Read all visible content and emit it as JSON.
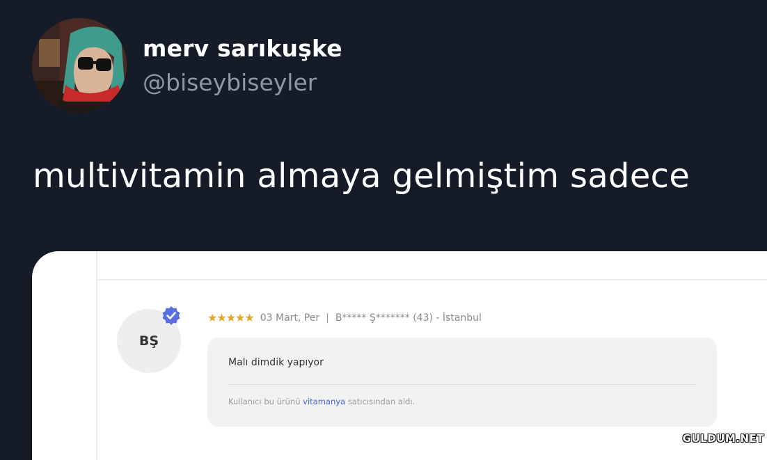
{
  "tweet": {
    "display_name": "merv sarıkuşke",
    "handle": "@biseybiseyler",
    "text": "multivitamin almaya gelmiştim sadece"
  },
  "review": {
    "user_initials": "BŞ",
    "stars": "★★★★★",
    "rating": 5,
    "date": "03 Mart, Per",
    "separator": "|",
    "reviewer": "B***** Ş******* (43) - İstanbul",
    "comment": "Malı dimdik yapıyor",
    "source_prefix": "Kullanıcı bu ürünü ",
    "seller": "vitamanya",
    "source_suffix": " satıcısından aldı."
  },
  "watermark": "GULDUM.NET",
  "colors": {
    "background": "#151c28",
    "star": "#e0a526",
    "link": "#3b63d6",
    "verified": "#5b6fe0"
  }
}
